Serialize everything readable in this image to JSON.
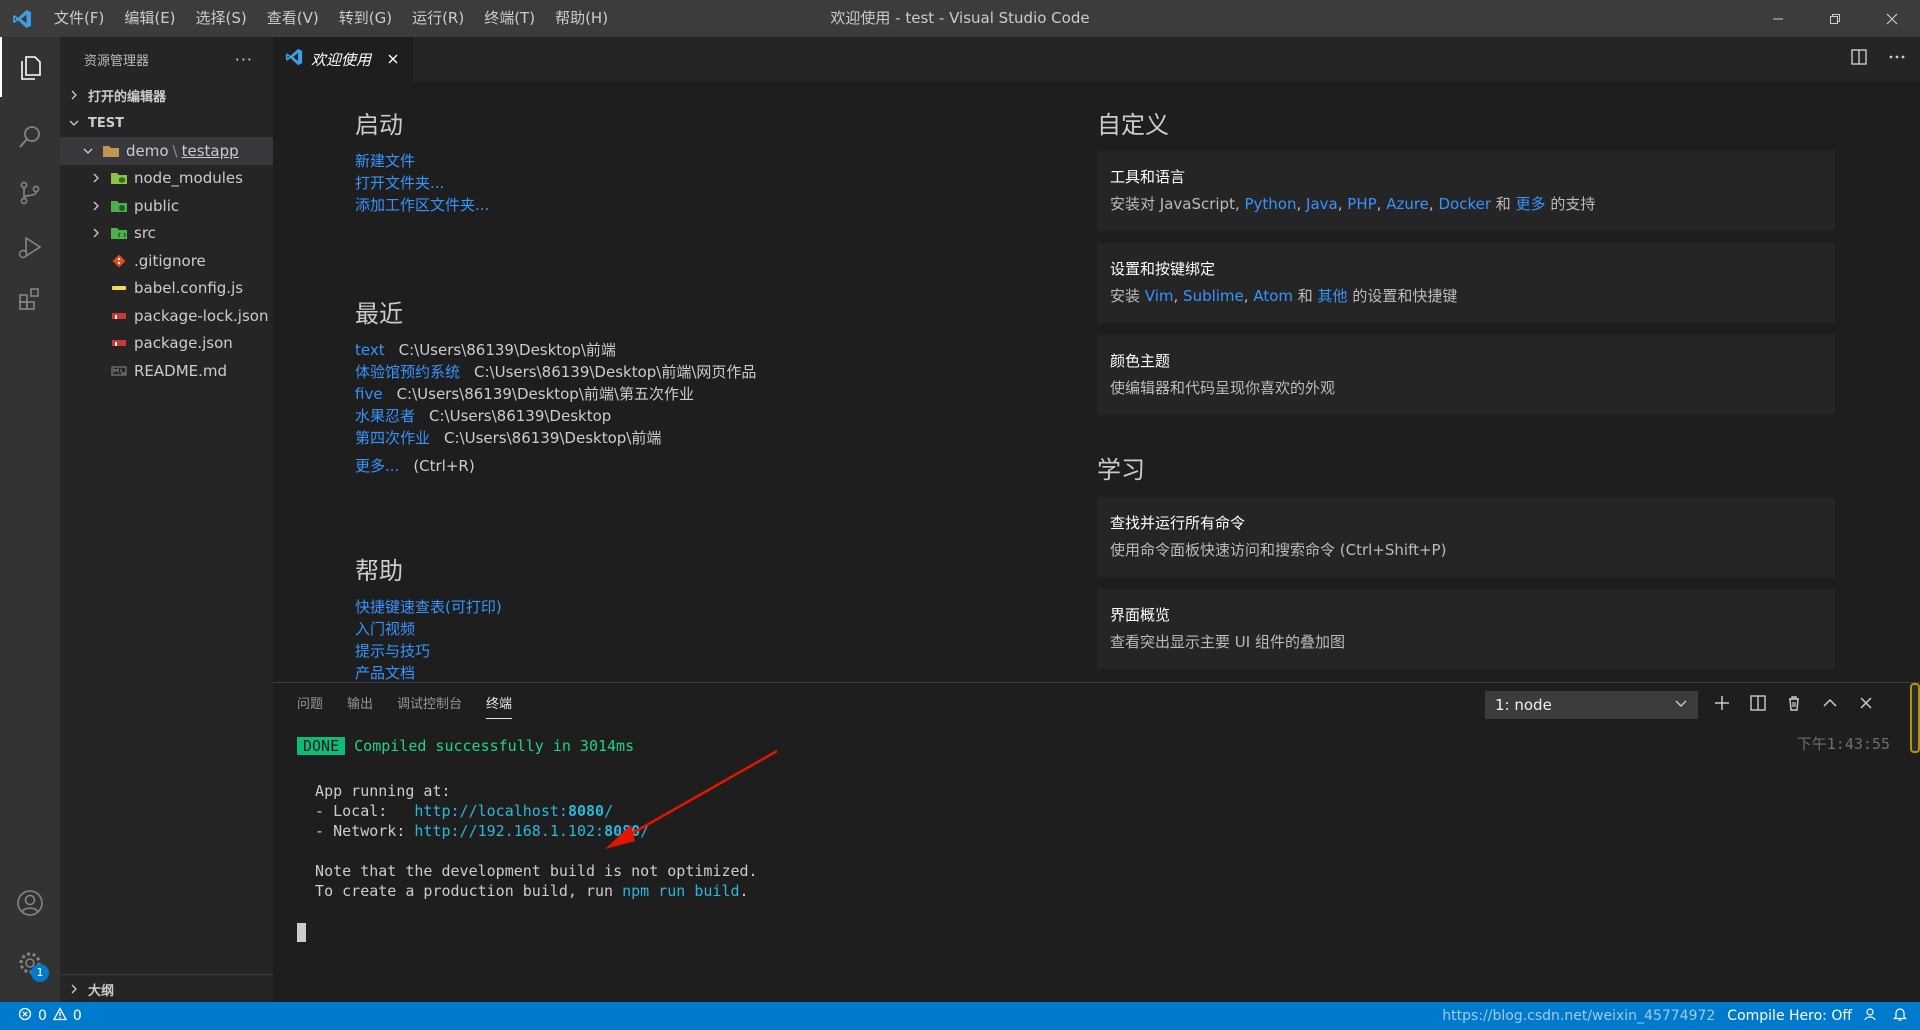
{
  "titlebar": {
    "menu": [
      "文件(F)",
      "编辑(E)",
      "选择(S)",
      "查看(V)",
      "转到(G)",
      "运行(R)",
      "终端(T)",
      "帮助(H)"
    ],
    "window_title": "欢迎使用 - test - Visual Studio Code"
  },
  "activity_bar": {
    "icons": [
      "explorer-icon",
      "search-icon",
      "source-control-icon",
      "run-debug-icon",
      "extensions-icon",
      "account-icon",
      "settings-gear-icon"
    ],
    "settings_badge": "1"
  },
  "sidebar": {
    "title": "资源管理器",
    "more": "···",
    "open_editors": "打开的编辑器",
    "workspace": "TEST",
    "tree": {
      "root_prefix": "demo",
      "root_sep": "\\",
      "root_name": "testapp",
      "items": [
        {
          "label": "node_modules",
          "icon": "folder-node-icon"
        },
        {
          "label": "public",
          "icon": "folder-public-icon"
        },
        {
          "label": "src",
          "icon": "folder-src-icon"
        },
        {
          "label": ".gitignore",
          "icon": "git-icon"
        },
        {
          "label": "babel.config.js",
          "icon": "babel-icon"
        },
        {
          "label": "package-lock.json",
          "icon": "npm-icon"
        },
        {
          "label": "package.json",
          "icon": "npm-icon"
        },
        {
          "label": "README.md",
          "icon": "markdown-icon"
        }
      ]
    },
    "outline": "大纲"
  },
  "editor": {
    "tab_label": "欢迎使用",
    "welcome": {
      "start": {
        "heading": "启动",
        "links": [
          "新建文件",
          "打开文件夹...",
          "添加工作区文件夹..."
        ]
      },
      "recent": {
        "heading": "最近",
        "items": [
          {
            "name": "text",
            "path": "C:\\Users\\86139\\Desktop\\前端"
          },
          {
            "name": "体验馆预约系统",
            "path": "C:\\Users\\86139\\Desktop\\前端\\网页作品"
          },
          {
            "name": "five",
            "path": "C:\\Users\\86139\\Desktop\\前端\\第五次作业"
          },
          {
            "name": "水果忍者",
            "path": "C:\\Users\\86139\\Desktop"
          },
          {
            "name": "第四次作业",
            "path": "C:\\Users\\86139\\Desktop\\前端"
          }
        ],
        "more_link": "更多...",
        "more_shortcut": "(Ctrl+R)"
      },
      "help": {
        "heading": "帮助",
        "links": [
          "快捷键速查表(可打印)",
          "入门视频",
          "提示与技巧",
          "产品文档"
        ]
      },
      "customize": {
        "heading": "自定义",
        "tools_title": "工具和语言",
        "tools_desc_prefix": "安装对 JavaScript, ",
        "tools_langs": [
          "Python",
          "Java",
          "PHP",
          "Azure",
          "Docker"
        ],
        "tools_and": " 和 ",
        "tools_more": "更多",
        "tools_suffix": " 的支持",
        "keys_title": "设置和按键绑定",
        "keys_prefix": "安装 ",
        "keys_editors": [
          "Vim",
          "Sublime",
          "Atom"
        ],
        "keys_and": " 和 ",
        "keys_other": "其他",
        "keys_suffix": " 的设置和快捷键",
        "theme_title": "颜色主题",
        "theme_desc": "使编辑器和代码呈现你喜欢的外观"
      },
      "learn": {
        "heading": "学习",
        "cmd_title": "查找并运行所有命令",
        "cmd_desc": "使用命令面板快速访问和搜索命令 (Ctrl+Shift+P)",
        "ui_title": "界面概览",
        "ui_desc": "查看突出显示主要 UI 组件的叠加图"
      }
    }
  },
  "panel": {
    "tabs": [
      "问题",
      "输出",
      "调试控制台",
      "终端"
    ],
    "active_tab": "终端",
    "terminal_select": "1: node",
    "timestamp": "下午1:43:55",
    "terminal": {
      "done_badge": "DONE",
      "compiled": "Compiled successfully in 3014ms",
      "app_running": "  App running at:",
      "local_label": "  - Local:   ",
      "local_url_a": "http://localhost:",
      "local_port": "8080",
      "local_url_b": "/",
      "network_label": "  - Network: ",
      "network_url_a": "http://192.168.1.102:",
      "network_port": "8080",
      "network_url_b": "/",
      "note1": "  Note that the development build is not optimized.",
      "note2_a": "  To create a production build, run ",
      "note2_cmd": "npm run build",
      "note2_b": "."
    }
  },
  "statusbar": {
    "errors": "0",
    "warnings": "0",
    "right_text": "Compile Hero: Off",
    "watermark": "https://blog.csdn.net/weixin_45774972"
  },
  "colors": {
    "accent": "#007acc",
    "link": "#3794ff",
    "terminal_green": "#23d18b",
    "terminal_cyan": "#29b8db",
    "annotation_arrow": "#e51400"
  }
}
